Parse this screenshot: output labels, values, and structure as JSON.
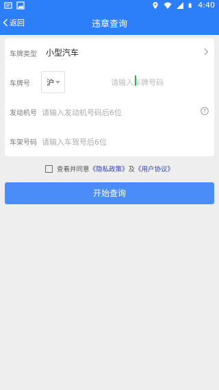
{
  "status_bar": {
    "time": "4:40",
    "icons": [
      "notification-icon",
      "photo-icon",
      "location-icon",
      "wifi-icon",
      "signal-icon",
      "battery-icon"
    ]
  },
  "nav": {
    "back_label": "返回",
    "title": "违章查询"
  },
  "form": {
    "vehicle_type_label": "车牌类型",
    "vehicle_type_value": "小型汽车",
    "plate_label": "车牌号",
    "province_value": "沪",
    "plate_placeholder": "请输入车牌号码",
    "engine_label": "发动机号",
    "engine_placeholder": "请输入发动机号码后6位",
    "frame_label": "车架号码",
    "frame_placeholder": "请输入车驾号后6位"
  },
  "agreement": {
    "prefix": "查看并同意",
    "privacy": "《隐私政策》",
    "and": "及",
    "user_agreement": "《用户协议》"
  },
  "submit_label": "开始查询",
  "colors": {
    "primary": "#2d7ff9",
    "button": "#4b8df8",
    "link": "#2a3fae",
    "background": "#eeeeee"
  }
}
